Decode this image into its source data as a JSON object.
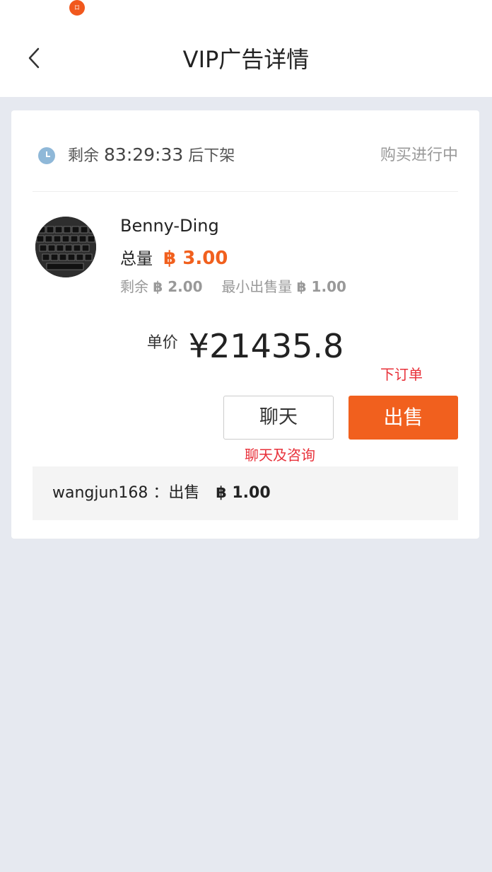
{
  "status_bar": {
    "app_icon": "app-badge-icon"
  },
  "header": {
    "title": "VIP广告详情",
    "back_icon": "chevron-left-icon"
  },
  "ad": {
    "timer_prefix": "剩余",
    "timer_time": "83:29:33",
    "timer_suffix": "后下架",
    "status": "购买进行中",
    "seller_name": "Benny-Ding",
    "total_label": "总量",
    "total_value": "฿ 3.00",
    "remaining_label": "剩余",
    "remaining_value": "฿ 2.00",
    "min_label": "最小出售量",
    "min_value": "฿ 1.00",
    "price_label": "单价",
    "price_value": "¥21435.8"
  },
  "actions": {
    "order_hint": "下订单",
    "chat_label": "聊天",
    "sell_label": "出售",
    "chat_hint": "聊天及咨询"
  },
  "history": {
    "user": "wangjun168",
    "separator": "：出售",
    "amount": "฿ 1.00"
  },
  "colors": {
    "accent": "#f1601e",
    "annotation": "#e8313a",
    "background": "#e6e9f0",
    "clock": "#8fb8d8"
  }
}
